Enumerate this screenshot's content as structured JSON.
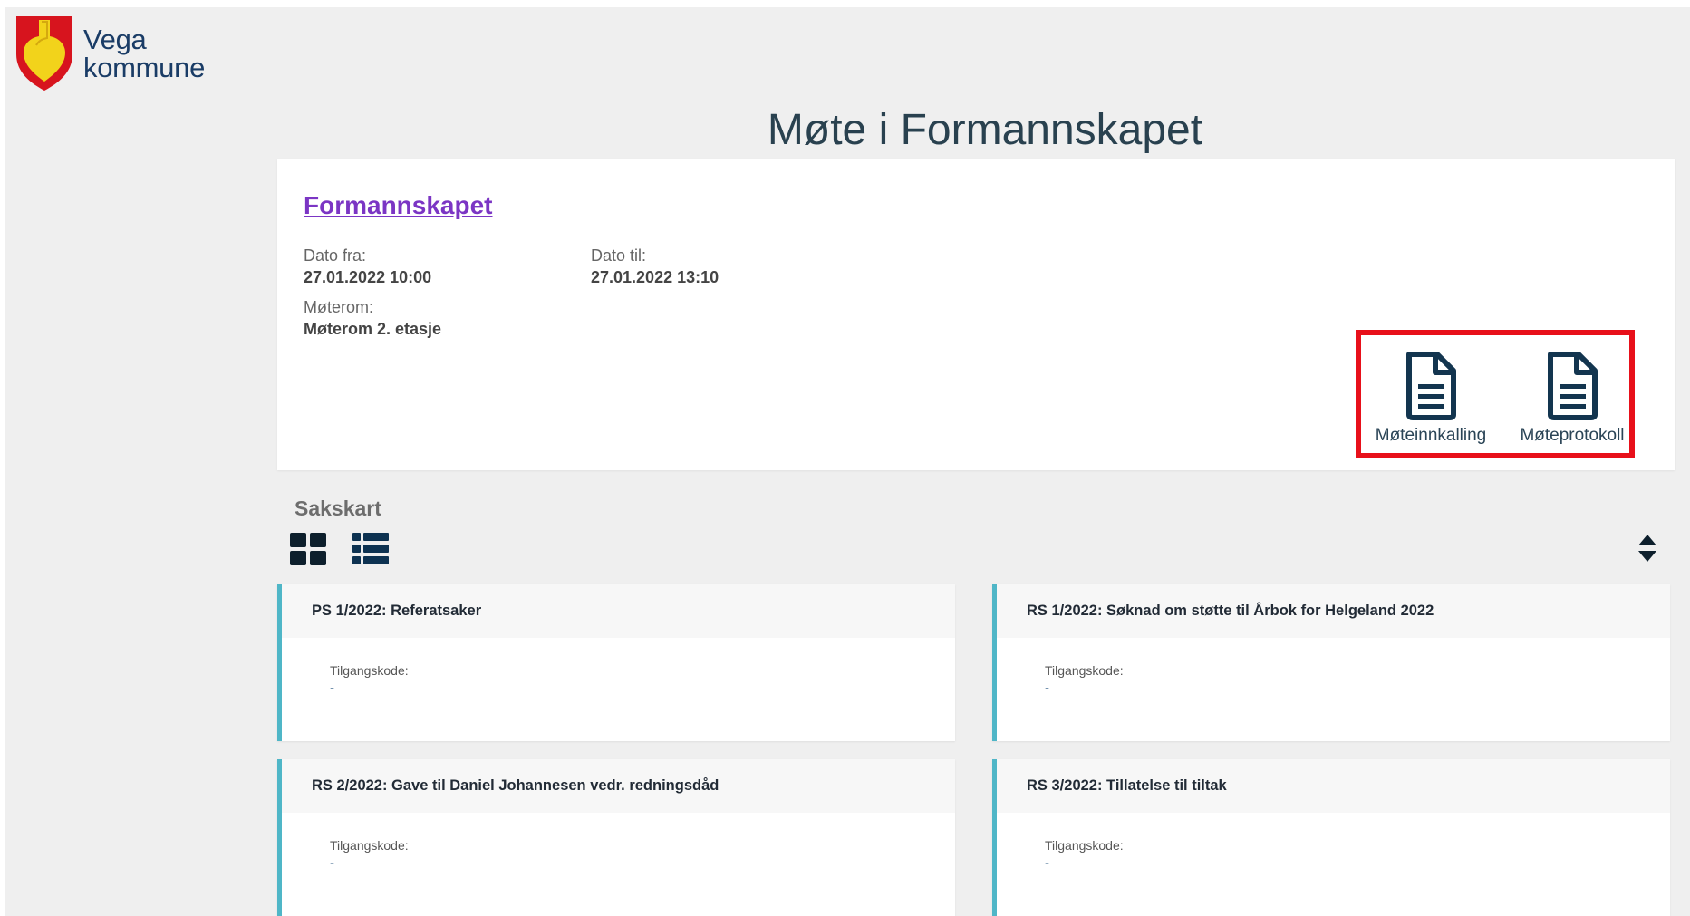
{
  "logo": {
    "line1": "Vega",
    "line2": "kommune",
    "shield_icon": "coat-of-arms-icon",
    "colors": {
      "shield": "#d7141e",
      "emblem": "#f2d31b",
      "text": "#1a3c66"
    }
  },
  "page": {
    "title": "Møte i Formannskapet"
  },
  "meeting": {
    "committee": "Formannskapet",
    "date_from_label": "Dato fra:",
    "date_from": "27.01.2022 10:00",
    "date_to_label": "Dato til:",
    "date_to": "27.01.2022 13:10",
    "room_label": "Møterom:",
    "room": "Møterom 2. etasje",
    "documents": [
      {
        "label": "Møteinnkalling",
        "icon": "document-icon"
      },
      {
        "label": "Møteprotokoll",
        "icon": "document-icon"
      }
    ],
    "highlight_color": "#e8101a"
  },
  "agenda": {
    "title": "Sakskart",
    "view_icons": [
      "grid-view-icon",
      "list-view-icon"
    ],
    "sort_icon": "sort-icon",
    "accent_color": "#4fb6c7",
    "cases": [
      {
        "title": "PS 1/2022: Referatsaker",
        "access_label": "Tilgangskode:",
        "access_value": "-"
      },
      {
        "title": "RS 1/2022: Søknad om støtte til Årbok for Helgeland 2022",
        "access_label": "Tilgangskode:",
        "access_value": "-"
      },
      {
        "title": "RS 2/2022: Gave til Daniel Johannesen vedr. redningsdåd",
        "access_label": "Tilgangskode:",
        "access_value": "-"
      },
      {
        "title": "RS 3/2022: Tillatelse til tiltak",
        "access_label": "Tilgangskode:",
        "access_value": "-"
      }
    ]
  }
}
